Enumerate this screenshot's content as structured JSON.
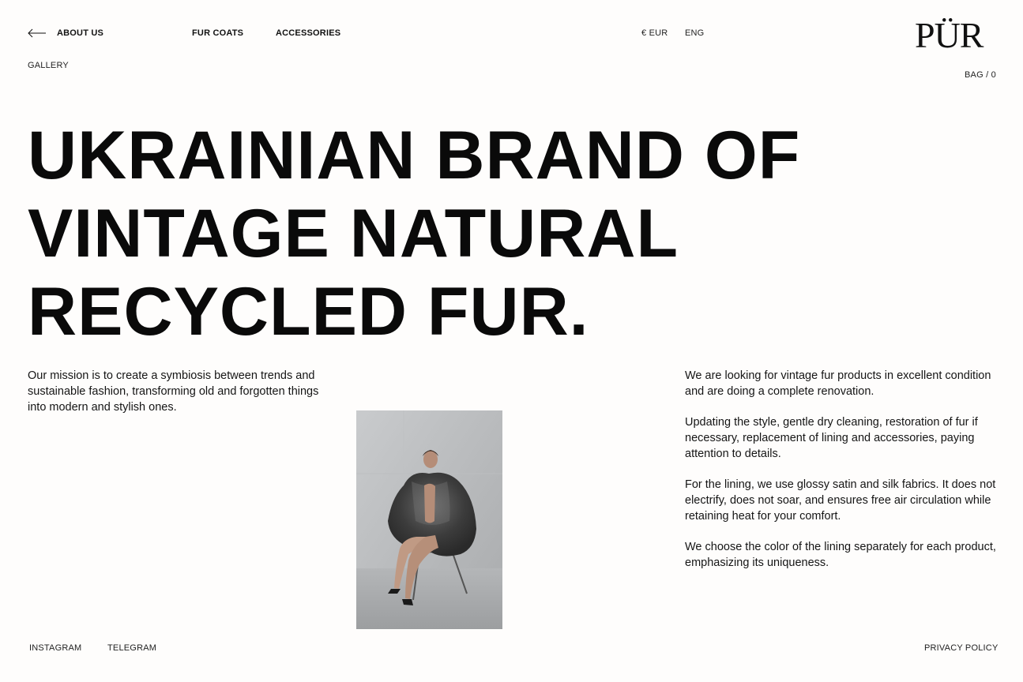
{
  "header": {
    "back_icon": "arrow-left-icon",
    "about_us": "ABOUT US",
    "gallery": "GALLERY",
    "fur_coats": "FUR COATS",
    "accessories": "ACCESSORIES",
    "currency": "€ EUR",
    "language": "ENG",
    "logo": "PÜR",
    "bag": "BAG / 0"
  },
  "hero": {
    "lines": [
      "UKRAINIAN BRAND OF",
      "VINTAGE NATURAL",
      "RECYCLED FUR."
    ]
  },
  "mission": {
    "text": "Our mission is to create a symbiosis between trends and sustainable fashion, transforming old and forgotten things into modern and stylish ones."
  },
  "details": {
    "paragraphs": [
      "We are looking for vintage fur products in excellent condition and are doing a complete renovation.",
      "Updating the style, gentle dry cleaning, restoration of fur if necessary, replacement of lining and accessories, paying attention to details.",
      "For the lining, we use glossy satin and silk fabrics. It does not electrify, does not soar, and ensures free air circulation while retaining heat for your comfort.",
      "We choose the color of the lining separately for each product, emphasizing its uniqueness."
    ]
  },
  "footer": {
    "instagram": "INSTAGRAM",
    "telegram": "TELEGRAM",
    "privacy": "PRIVACY POLICY"
  },
  "colors": {
    "background": "#fefdfc",
    "text": "#111111"
  }
}
